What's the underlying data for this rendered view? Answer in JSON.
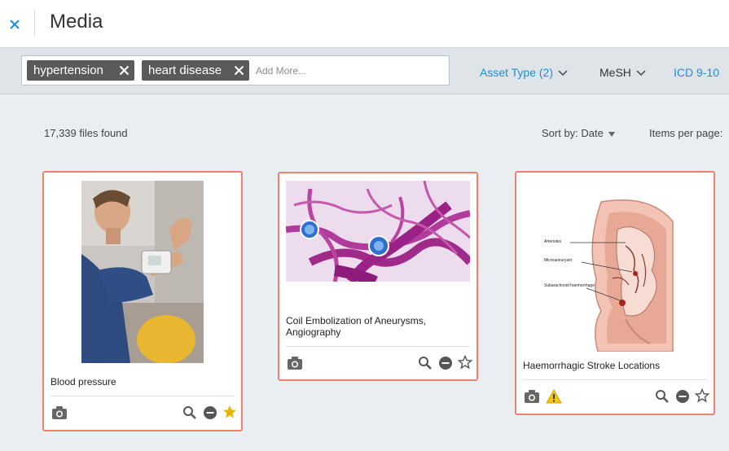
{
  "header": {
    "title": "Media",
    "close_icon": "close-icon"
  },
  "filters": {
    "chips": [
      {
        "label": "hypertension"
      },
      {
        "label": "heart disease"
      }
    ],
    "search_placeholder": "Add More...",
    "dropdowns": {
      "asset_type": "Asset Type (2)",
      "mesh": "MeSH",
      "icd": "ICD 9-10"
    }
  },
  "results": {
    "count_text": "17,339 files found",
    "sort_label": "Sort by: Date",
    "items_per_page_label": "Items per page:"
  },
  "cards": [
    {
      "title": "Blood pressure",
      "media_icon": "camera-icon",
      "favorite": true
    },
    {
      "title": "Coil Embolization of Aneurysms, Angiography",
      "media_icon": "camera-icon",
      "favorite": false
    },
    {
      "title": "Haemorrhagic Stroke Locations",
      "media_icon": "camera-icon",
      "warning": true,
      "favorite": false
    }
  ],
  "diagram_labels": {
    "label_1": "Arterioles",
    "label_2": "Microaneurysm",
    "label_3": "Subarachnoid haemorrhage"
  },
  "colors": {
    "accent_blue": "#1a8fd6",
    "card_border": "#f08070",
    "star_gold": "#e8b400",
    "warning_yellow": "#f1c40f"
  }
}
